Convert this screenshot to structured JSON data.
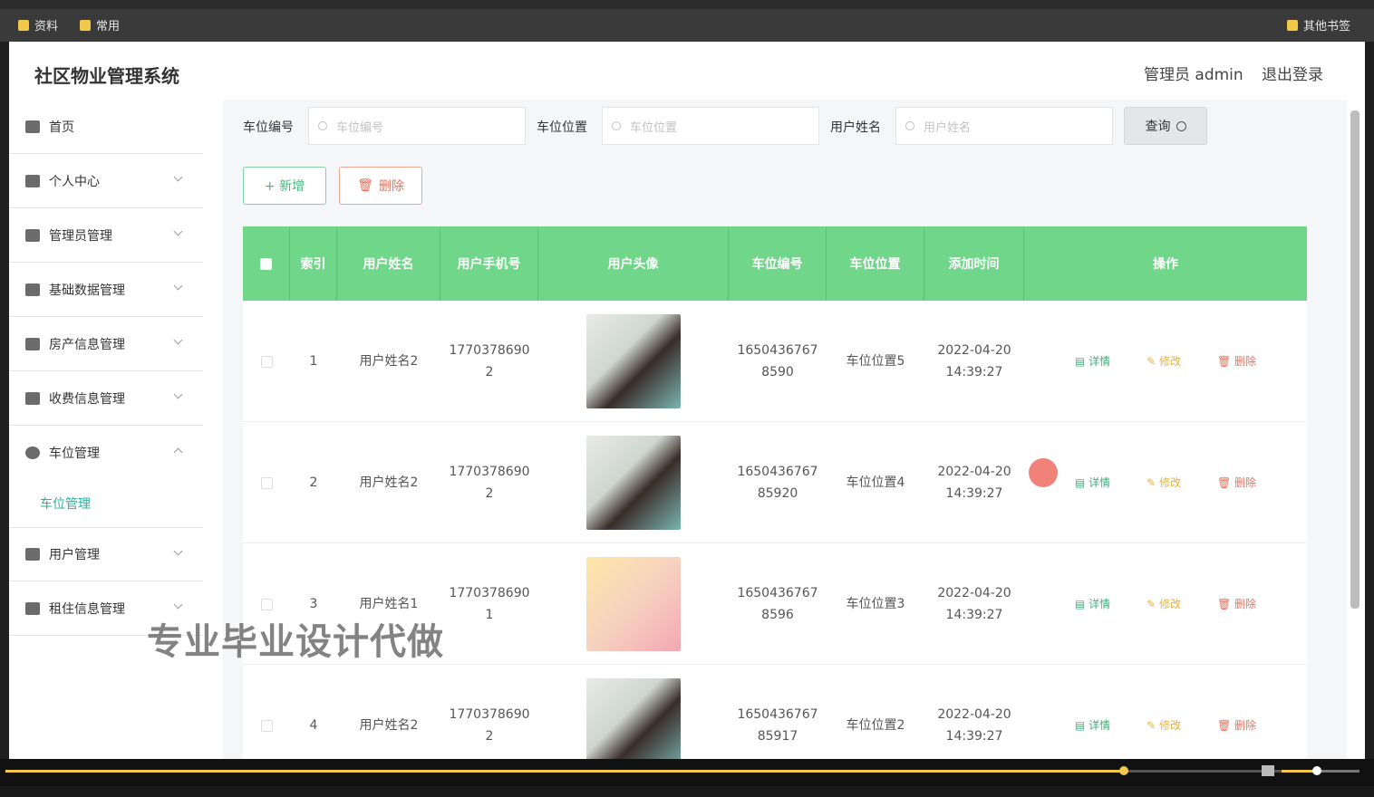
{
  "bookmarks": {
    "items": [
      "资料",
      "常用"
    ],
    "right": "其他书签"
  },
  "header": {
    "title": "社区物业管理系统",
    "admin": "管理员 admin",
    "logout": "退出登录"
  },
  "sidebar": {
    "items": [
      {
        "label": "首页",
        "icon": "home-icon"
      },
      {
        "label": "个人中心",
        "icon": "user-icon"
      },
      {
        "label": "管理员管理",
        "icon": "admin-icon"
      },
      {
        "label": "基础数据管理",
        "icon": "list-icon"
      },
      {
        "label": "房产信息管理",
        "icon": "grid-icon"
      },
      {
        "label": "收费信息管理",
        "icon": "clipboard-icon"
      },
      {
        "label": "车位管理",
        "icon": "clock-icon"
      },
      {
        "label": "用户管理",
        "icon": "user-card-icon"
      },
      {
        "label": "租住信息管理",
        "icon": "monitor-icon"
      }
    ],
    "sub_item": "车位管理"
  },
  "filters": {
    "space_no_label": "车位编号",
    "space_no_placeholder": "车位编号",
    "space_loc_label": "车位位置",
    "space_loc_placeholder": "车位位置",
    "user_name_label": "用户姓名",
    "user_name_placeholder": "用户姓名",
    "query": "查询"
  },
  "actions": {
    "add": "+ 新增",
    "delete": "删除"
  },
  "table": {
    "headers": [
      "索引",
      "用户姓名",
      "用户手机号",
      "用户头像",
      "车位编号",
      "车位位置",
      "添加时间",
      "操作"
    ],
    "rows": [
      {
        "index": "1",
        "name": "用户姓名2",
        "phone1": "1770378690",
        "phone2": "2",
        "avatar": "girl",
        "code1": "1650436767",
        "code2": "8590",
        "loc": "车位位置5",
        "date": "2022-04-20",
        "time": "14:39:27"
      },
      {
        "index": "2",
        "name": "用户姓名2",
        "phone1": "1770378690",
        "phone2": "2",
        "avatar": "girl",
        "code1": "1650436767",
        "code2": "85920",
        "loc": "车位位置4",
        "date": "2022-04-20",
        "time": "14:39:27"
      },
      {
        "index": "3",
        "name": "用户姓名1",
        "phone1": "1770378690",
        "phone2": "1",
        "avatar": "anime",
        "code1": "1650436767",
        "code2": "8596",
        "loc": "车位位置3",
        "date": "2022-04-20",
        "time": "14:39:27"
      },
      {
        "index": "4",
        "name": "用户姓名2",
        "phone1": "1770378690",
        "phone2": "2",
        "avatar": "girl",
        "code1": "1650436767",
        "code2": "85917",
        "loc": "车位位置2",
        "date": "2022-04-20",
        "time": "14:39:27"
      }
    ],
    "ops": {
      "detail": "详情",
      "edit": "修改",
      "delete": "删除"
    }
  },
  "watermark": "专业毕业设计代做",
  "player": {
    "progress": 0.826,
    "volume": 0.45
  }
}
